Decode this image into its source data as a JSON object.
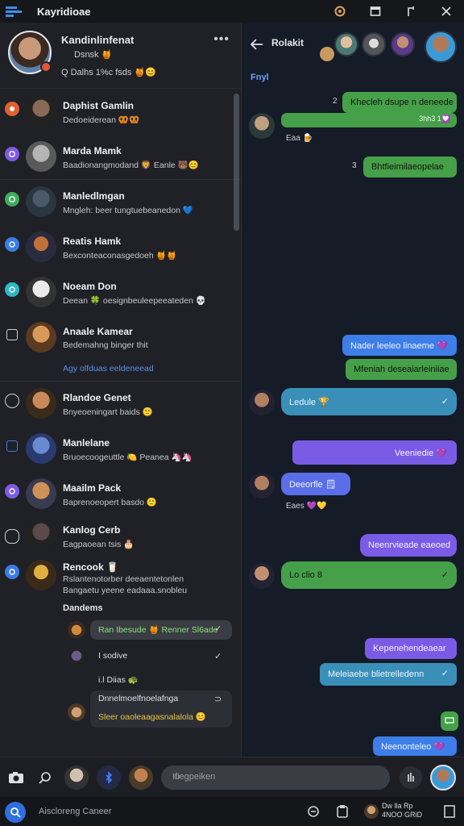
{
  "window": {
    "title": "Kayridioae"
  },
  "profile": {
    "name": "Kandinlinfenat",
    "sub": "Dsnsk 🍯",
    "status": "Q Dalhs 1%c fsds 🍯😊"
  },
  "chats": [
    {
      "name": "Daphist Gamlin",
      "preview": "Dedoeiderean 🥨🥨",
      "lead_color": "#e0612f"
    },
    {
      "name": "Marda Mamk",
      "preview": "Baadionangmodand 🦁 Eanle 🐻😊",
      "lead_color": "#7c5ce6"
    },
    {
      "name": "Manledlmgan",
      "preview": "Mngleh: beer tungtuebeanedon 💙",
      "lead_color": "#3fae5b"
    },
    {
      "name": "Reatis Hamk",
      "preview": "Bexconteaconasgedoeh 🍯🍯",
      "lead_color": "#3a7de6"
    },
    {
      "name": "Noeam Don",
      "preview": "Deean 🍀 oesignbeuleepeeateden 💀",
      "lead_color": "#2fb8c8"
    },
    {
      "name": "Anaale Kamear",
      "preview": "Bedemahng binger thit",
      "lead_color": ""
    }
  ],
  "link_text": "Agy olfduas eeldeneead",
  "chats2": [
    {
      "name": "Rlandoe Genet",
      "preview": "Bnyeoeningart baids 🙂"
    },
    {
      "name": "Manlelane",
      "preview": "Bruoecoogeuttle 🍋 Peanea 🦄🦄"
    },
    {
      "name": "Maailm Pack",
      "preview": "Baprenoeopert basdo 🙂"
    },
    {
      "name": "Kanlog Cerb",
      "preview": "Eagpaoean tsis 🎂"
    },
    {
      "name": "Rencook 🥛",
      "preview": "Rslantenotorber deeaentetonlen",
      "preview2": "Bangaetu yeene eadaaa.snobleu"
    }
  ],
  "subthread": {
    "heading": "Dandems",
    "items": [
      {
        "text": "Ran Ibesude 🍯 Renner Sl6ade",
        "color": "#8fe07a"
      },
      {
        "text": "I  sodive",
        "color": "#e0e0e4"
      },
      {
        "text": "i.l  Diias 🐢",
        "color": "#e0e0e4"
      },
      {
        "text": "Dnnelmoelfnoelafnga",
        "color": "#e0e0e4"
      },
      {
        "text": "Sleer oaoleaagasnalalola 😊",
        "color": "#e7c44a"
      }
    ]
  },
  "conversation": {
    "name": "Rolakit",
    "fyi": "Fnyl",
    "messages": [
      {
        "text": "Khecleh dsupe n deneede",
        "style": "green",
        "meta": "2"
      },
      {
        "text": "",
        "style": "green",
        "meta": "3hh3 1💟"
      },
      {
        "text": "Eaa 🍺",
        "style": "caption"
      },
      {
        "text": "Bhtfieimilaeopelae",
        "style": "green",
        "meta": "3"
      },
      {
        "text": "Nader leeleo linaeme 💜",
        "style": "blue"
      },
      {
        "text": "Mfeniah deseaiarleiniiae",
        "style": "green"
      },
      {
        "text": "Ledule 🏆",
        "style": "teal",
        "check": "✓"
      },
      {
        "text": "Veeniedie 💜",
        "style": "purple"
      },
      {
        "text": "Deeorfle 🗒",
        "style": "blue"
      },
      {
        "text": "Eaes 💜💛",
        "style": "caption"
      },
      {
        "text": "Neenrvieade eaeoed",
        "style": "purple"
      },
      {
        "text": "Lo clio 8",
        "style": "green",
        "check": "✓"
      },
      {
        "text": "Kepenehendeaear",
        "style": "purple"
      },
      {
        "text": "Meleiaebe blietrelledenn",
        "style": "teal",
        "check": "✓"
      },
      {
        "text": "",
        "style": "green",
        "icon": "chat-icon"
      },
      {
        "text": "Neenonteleo 💜",
        "style": "blue"
      }
    ]
  },
  "composer": {
    "placeholder": "Ifiegpeiken"
  },
  "statusbar": {
    "search": "Aiscloreng Caneer",
    "clock": "Dw lla Rp",
    "date": "4NOO GRiD"
  },
  "colors": {
    "green": "#46a049",
    "blue": "#3d7ee8",
    "purple": "#7a5be6",
    "teal": "#3a8fb8",
    "background": "#151b27"
  }
}
